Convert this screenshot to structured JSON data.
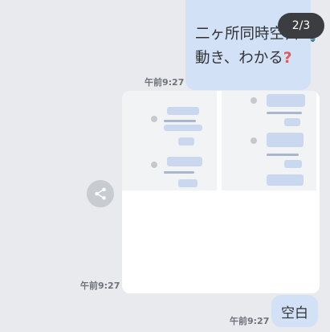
{
  "messages": {
    "top_text_line1": "二ヶ所同時空白",
    "top_text_line2": "動き、わかる",
    "question_icon": "?",
    "lightbulb_icon": "💡",
    "page_counter": "2/3",
    "time_1": "午前9:27",
    "time_2": "午前9:27",
    "time_3": "午前9:27",
    "bottom_text": "空白"
  },
  "icons": {
    "share": "share-icon"
  },
  "colors": {
    "background": "#e8eaed",
    "bubble": "#d3e1f7",
    "counter_bg": "#3b3d40"
  }
}
